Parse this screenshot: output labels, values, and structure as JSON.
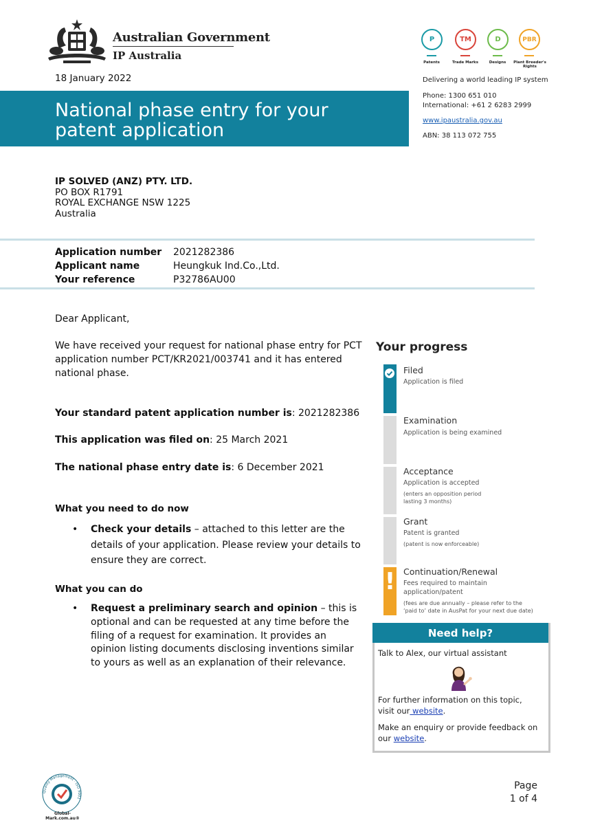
{
  "header": {
    "gov_name": "Australian Government",
    "agency_name": "IP Australia",
    "rights": [
      {
        "code": "P",
        "label": "Patents",
        "color": "#1a9aa6"
      },
      {
        "code": "TM",
        "label": "Trade Marks",
        "color": "#d9443a"
      },
      {
        "code": "D",
        "label": "Designs",
        "color": "#6cbb4a"
      },
      {
        "code": "PBR",
        "label": "Plant Breeder's Rights",
        "color": "#f0a326"
      }
    ]
  },
  "contact": {
    "tagline": "Delivering a world leading IP system",
    "phone": "Phone:  1300 651 010",
    "international": "International:  +61 2 6283 2999",
    "website": "www.ipaustralia.gov.au",
    "abn": "ABN:  38 113 072 755"
  },
  "date": "18 January 2022",
  "title": "National phase entry for your patent application",
  "address": {
    "company": "IP SOLVED (ANZ) PTY. LTD.",
    "line1": "PO BOX R1791",
    "line2": "ROYAL EXCHANGE NSW 1225",
    "country": "Australia"
  },
  "application": {
    "number_label": "Application number",
    "number": "2021282386",
    "applicant_label": "Applicant name",
    "applicant": "Heungkuk Ind.Co.,Ltd.",
    "reference_label": "Your reference",
    "reference": "P32786AU00"
  },
  "letter": {
    "salutation": "Dear Applicant,",
    "intro": "We have received your request for national phase entry for PCT application number PCT/KR2021/003741 and it has entered national phase.",
    "standard_label": "Your standard patent application number is",
    "standard_value": ": 2021282386",
    "filed_label": "This application was filed on",
    "filed_value": ": 25 March 2021",
    "npe_label": "The national phase entry date is",
    "npe_value": ": 6 December 2021",
    "todo_heading": "What you need to do now",
    "todo_bold": "Check your details",
    "todo_text": " – attached to this letter are the details of your application. Please review your details to ensure they are correct.",
    "can_heading": "What you can do",
    "can_bold": "Request a preliminary search and opinion",
    "can_text": " – this is optional and can be requested at any time before the filing of a request for examination. It provides an opinion listing documents disclosing inventions similar to yours as well as an explanation of their relevance."
  },
  "progress": {
    "title": "Your progress",
    "steps": [
      {
        "name": "Filed",
        "desc": "Application is filed",
        "sub": ""
      },
      {
        "name": "Examination",
        "desc": "Application is being examined",
        "sub": ""
      },
      {
        "name": "Acceptance",
        "desc": "Application is accepted",
        "sub": "(enters an opposition period",
        "sub2": "lasting 3 months)"
      },
      {
        "name": "Grant",
        "desc": "Patent is granted",
        "sub": "(patent is now enforceable)"
      },
      {
        "name": "Continuation/Renewal",
        "desc": "Fees required to maintain",
        "desc2": "application/patent",
        "sub": "(fees are due annually – please refer to the",
        "sub2": "‘paid to’ date in AusPat for your next due date)"
      }
    ]
  },
  "help": {
    "title": "Need help?",
    "assistant": "Talk to Alex, our virtual assistant",
    "further_prefix": "For further information on this topic, visit our",
    "further_link": " website",
    "further_suffix": ".",
    "enquiry_prefix": "Make an enquiry or provide feedback on our ",
    "enquiry_link": "website",
    "enquiry_suffix": "."
  },
  "footer": {
    "cert_ring": "Quality Management · ISO 9001",
    "cert_label": "Global-Mark.com.au®",
    "page_label": "Page",
    "page_of": "1 of 4"
  }
}
